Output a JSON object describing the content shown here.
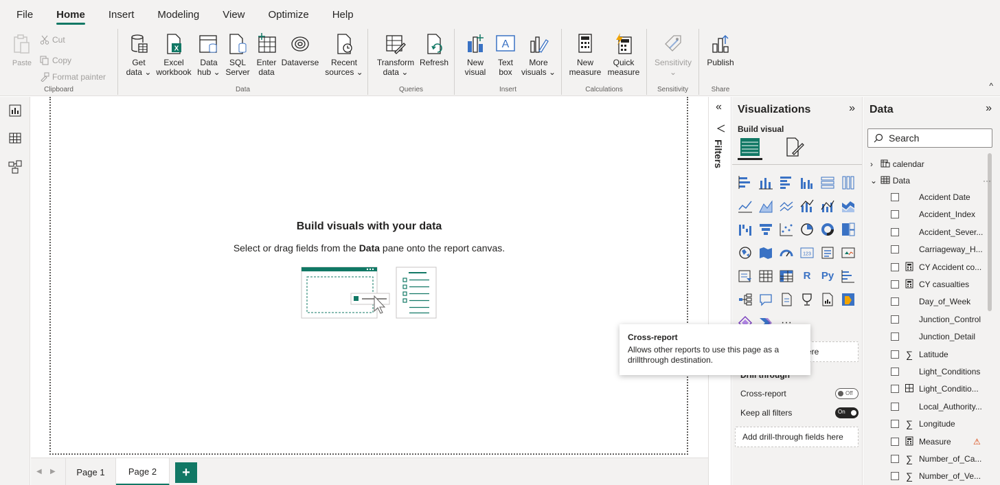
{
  "menu": {
    "items": [
      "File",
      "Home",
      "Insert",
      "Modeling",
      "View",
      "Optimize",
      "Help"
    ],
    "active": "Home"
  },
  "ribbon": {
    "clipboard": {
      "paste": "Paste",
      "cut": "Cut",
      "copy": "Copy",
      "format_painter": "Format painter",
      "label": "Clipboard"
    },
    "data": {
      "get_data": [
        "Get",
        "data ⌄"
      ],
      "excel": [
        "Excel",
        "workbook"
      ],
      "data_hub": [
        "Data",
        "hub ⌄"
      ],
      "sql": [
        "SQL",
        "Server"
      ],
      "enter": [
        "Enter",
        "data"
      ],
      "dataverse": [
        "Dataverse",
        ""
      ],
      "recent": [
        "Recent",
        "sources ⌄"
      ],
      "label": "Data"
    },
    "queries": {
      "transform": [
        "Transform",
        "data ⌄"
      ],
      "refresh": [
        "Refresh",
        ""
      ],
      "label": "Queries"
    },
    "insert": {
      "new_visual": [
        "New",
        "visual"
      ],
      "text_box": [
        "Text",
        "box"
      ],
      "more_visuals": [
        "More",
        "visuals ⌄"
      ],
      "label": "Insert"
    },
    "calculations": {
      "new_measure": [
        "New",
        "measure"
      ],
      "quick_measure": [
        "Quick",
        "measure"
      ],
      "label": "Calculations"
    },
    "sensitivity": {
      "btn": [
        "Sensitivity",
        "⌄"
      ],
      "label": "Sensitivity"
    },
    "share": {
      "publish": [
        "Publish",
        ""
      ],
      "label": "Share"
    },
    "collapse": "^"
  },
  "canvas": {
    "title": "Build visuals with your data",
    "sub_prefix": "Select or drag fields from the ",
    "sub_bold": "Data",
    "sub_suffix": " pane onto the report canvas."
  },
  "pages": {
    "prev": "◀",
    "next": "▶",
    "tabs": [
      "Page 1",
      "Page 2"
    ],
    "active": "Page 2",
    "add": "+"
  },
  "filters": {
    "collapse": "«",
    "label": "Filters"
  },
  "visualizations": {
    "title": "Visualizations",
    "expand": "»",
    "build_visual": "Build visual",
    "more": "···",
    "well_partial": "ere",
    "drill_through": "Drill through",
    "cross_report": "Cross-report",
    "cross_report_state": "Off",
    "keep_all_filters": "Keep all filters",
    "keep_all_filters_state": "On",
    "add_drill": "Add drill-through fields here"
  },
  "tooltip": {
    "title": "Cross-report",
    "body": "Allows other reports to use this page as a drillthrough destination."
  },
  "data_pane": {
    "title": "Data",
    "expand": "»",
    "search_placeholder": "Search",
    "tables": [
      {
        "name": "calendar",
        "expanded": false
      },
      {
        "name": "Data",
        "expanded": true,
        "more": "···"
      }
    ],
    "fields": [
      {
        "name": "Accident Date",
        "type": ""
      },
      {
        "name": "Accident_Index",
        "type": ""
      },
      {
        "name": "Accident_Sever...",
        "type": ""
      },
      {
        "name": "Carriageway_H...",
        "type": ""
      },
      {
        "name": "CY Accident co...",
        "type": "calc"
      },
      {
        "name": "CY casualties",
        "type": "calc"
      },
      {
        "name": "Day_of_Week",
        "type": ""
      },
      {
        "name": "Junction_Control",
        "type": ""
      },
      {
        "name": "Junction_Detail",
        "type": ""
      },
      {
        "name": "Latitude",
        "type": "sum"
      },
      {
        "name": "Light_Conditions",
        "type": ""
      },
      {
        "name": "Light_Conditio...",
        "type": "table"
      },
      {
        "name": "Local_Authority...",
        "type": ""
      },
      {
        "name": "Longitude",
        "type": "sum"
      },
      {
        "name": "Measure",
        "type": "calc",
        "warning": "⚠"
      },
      {
        "name": "Number_of_Ca...",
        "type": "sum"
      },
      {
        "name": "Number_of_Ve...",
        "type": "sum"
      }
    ]
  },
  "colors": {
    "accent": "#117865",
    "ribbon_bg": "#f3f2f1",
    "warning": "#d83b01",
    "visual_blue": "#3a72c4"
  }
}
